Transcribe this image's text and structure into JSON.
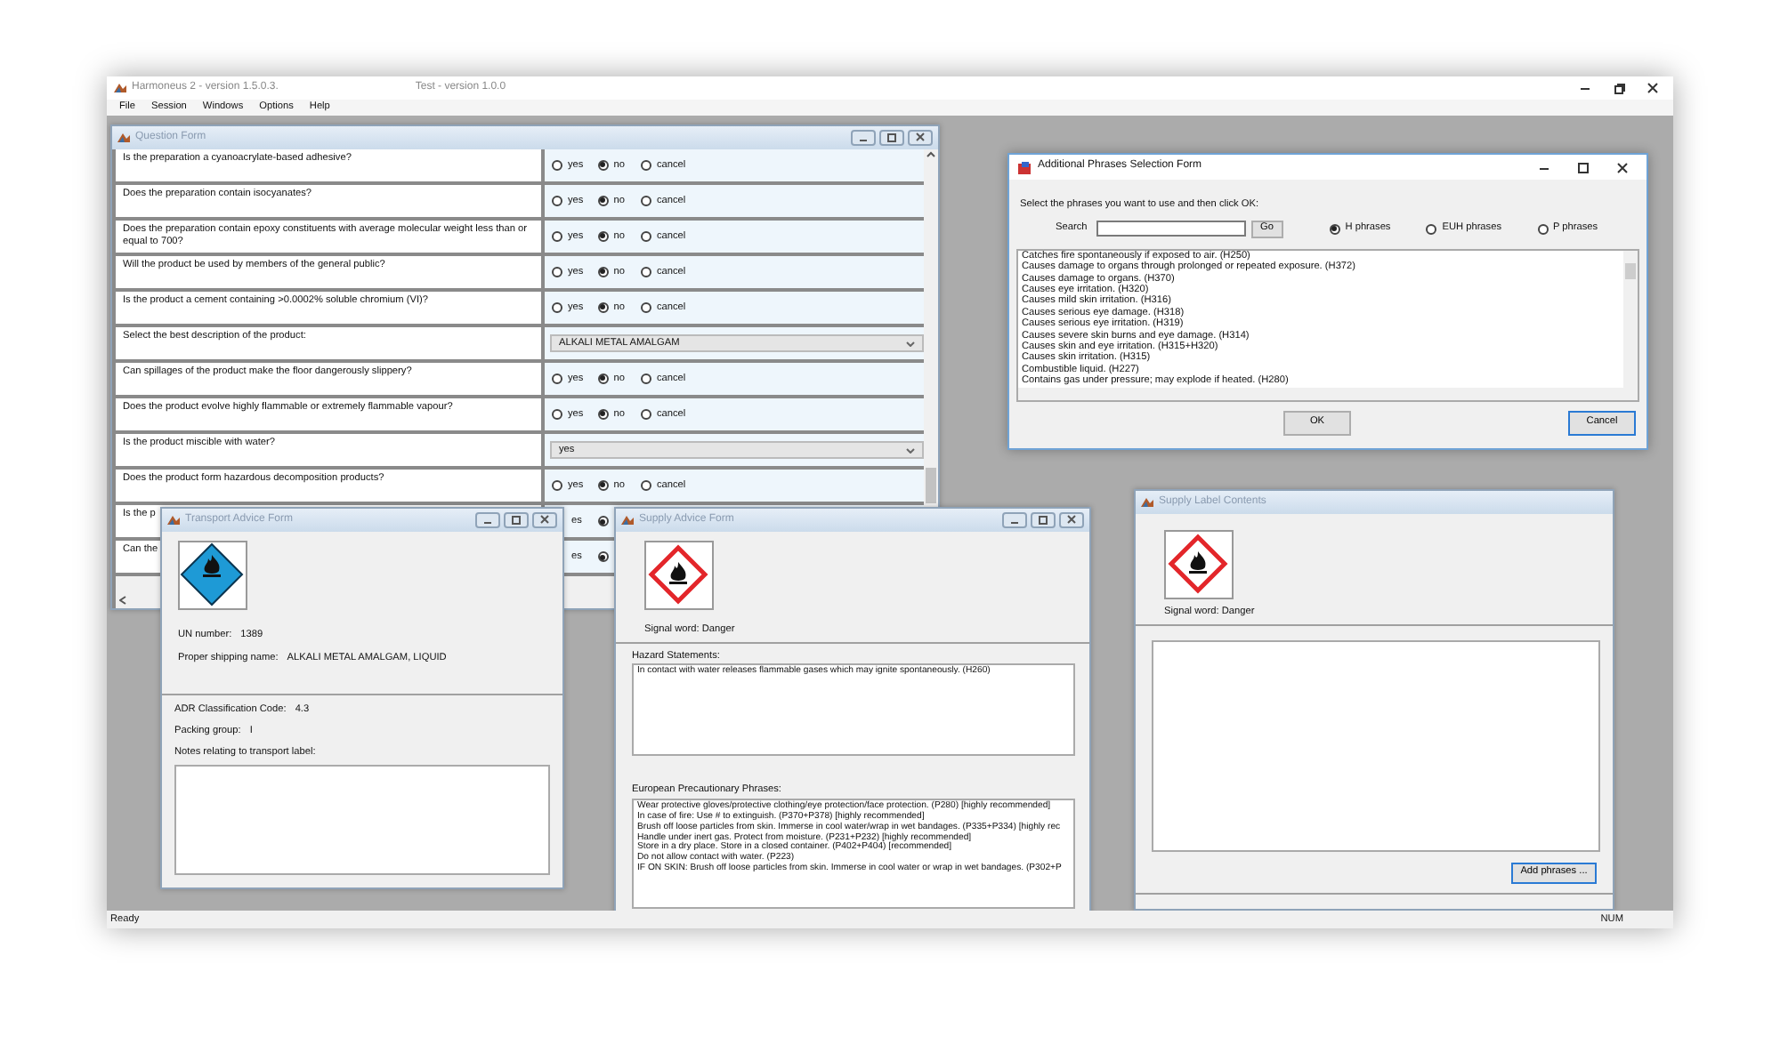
{
  "app": {
    "title": "Harmoneus 2 - version 1.5.0.3.",
    "subtitle": "Test - version 1.0.0"
  },
  "menu": [
    "File",
    "Session",
    "Windows",
    "Options",
    "Help"
  ],
  "question_form": {
    "title": "Question Form",
    "rows": [
      {
        "kind": "radio",
        "question": "Is the preparation a cyanoacrylate-based adhesive?",
        "options": [
          {
            "label": "yes",
            "selected": false
          },
          {
            "label": "no",
            "selected": true
          },
          {
            "label": "cancel",
            "selected": false
          }
        ]
      },
      {
        "kind": "radio",
        "question": "Does the preparation contain isocyanates?",
        "options": [
          {
            "label": "yes",
            "selected": false
          },
          {
            "label": "no",
            "selected": true
          },
          {
            "label": "cancel",
            "selected": false
          }
        ]
      },
      {
        "kind": "radio",
        "question": "Does the preparation contain epoxy constituents with average molecular weight less than or equal to 700?",
        "options": [
          {
            "label": "yes",
            "selected": false
          },
          {
            "label": "no",
            "selected": true
          },
          {
            "label": "cancel",
            "selected": false
          }
        ]
      },
      {
        "kind": "radio",
        "question": "Will the product be used by members of the general public?",
        "options": [
          {
            "label": "yes",
            "selected": false
          },
          {
            "label": "no",
            "selected": true
          },
          {
            "label": "cancel",
            "selected": false
          }
        ]
      },
      {
        "kind": "radio",
        "question": "Is the product a cement containing >0.0002% soluble chromium (VI)?",
        "options": [
          {
            "label": "yes",
            "selected": false
          },
          {
            "label": "no",
            "selected": true
          },
          {
            "label": "cancel",
            "selected": false
          }
        ]
      },
      {
        "kind": "select",
        "question": "Select the best description of the product:",
        "value": "ALKALI METAL AMALGAM"
      },
      {
        "kind": "radio",
        "question": "Can spillages of the product make the floor dangerously slippery?",
        "options": [
          {
            "label": "yes",
            "selected": false
          },
          {
            "label": "no",
            "selected": true
          },
          {
            "label": "cancel",
            "selected": false
          }
        ]
      },
      {
        "kind": "radio",
        "question": "Does the product evolve highly flammable or extremely flammable vapour?",
        "options": [
          {
            "label": "yes",
            "selected": false
          },
          {
            "label": "no",
            "selected": true
          },
          {
            "label": "cancel",
            "selected": false
          }
        ]
      },
      {
        "kind": "select",
        "question": "Is the product miscible with water?",
        "value": "yes"
      },
      {
        "kind": "radio",
        "question": "Does the product form hazardous decomposition products?",
        "options": [
          {
            "label": "yes",
            "selected": false
          },
          {
            "label": "no",
            "selected": true
          },
          {
            "label": "cancel",
            "selected": false
          }
        ]
      },
      {
        "kind": "covered",
        "question": "Is the p",
        "fragment": "es",
        "selected": true
      },
      {
        "kind": "covered",
        "question": "Can the",
        "fragment": "es",
        "selected": true
      }
    ]
  },
  "phrases_form": {
    "title": "Additional Phrases Selection Form",
    "instruction": "Select the phrases you want to use and then click OK:",
    "search_label": "Search",
    "search_button": "Go",
    "types": [
      {
        "label": "H phrases",
        "selected": true
      },
      {
        "label": "EUH phrases",
        "selected": false
      },
      {
        "label": "P phrases",
        "selected": false
      }
    ],
    "phrases": [
      "Catches fire spontaneously if exposed to air. (H250)",
      "Causes damage to organs through prolonged or repeated exposure. (H372)",
      "Causes damage to organs. (H370)",
      "Causes eye irritation. (H320)",
      "Causes mild skin irritation. (H316)",
      "Causes serious eye damage. (H318)",
      "Causes serious eye irritation. (H319)",
      "Causes severe skin burns and eye damage. (H314)",
      "Causes skin and eye irritation. (H315+H320)",
      "Causes skin irritation. (H315)",
      "Combustible liquid. (H227)",
      "Contains gas under pressure; may explode if heated. (H280)"
    ],
    "buttons": [
      {
        "label": "OK",
        "focused": false
      },
      {
        "label": "Cancel",
        "focused": true
      }
    ]
  },
  "transport_form": {
    "title": "Transport Advice Form",
    "fields": [
      {
        "label": "UN number:",
        "value": "1389"
      },
      {
        "label": "Proper shipping name:",
        "value": "ALKALI METAL AMALGAM, LIQUID"
      }
    ],
    "classification": [
      {
        "label": "ADR Classification Code:",
        "value": "4.3"
      },
      {
        "label": "Packing group:",
        "value": "I"
      }
    ],
    "notes_label": "Notes relating to transport label:"
  },
  "supply_form": {
    "title": "Supply Advice Form",
    "signal_word": "Signal word: Danger",
    "hazard_label": "Hazard Statements:",
    "hazard_lines": [
      "In contact with water releases flammable gases which may ignite spontaneously. (H260)"
    ],
    "precautionary_label": "European Precautionary Phrases:",
    "precautionary_lines": [
      "Wear protective gloves/protective clothing/eye protection/face protection. (P280) [highly recommended]",
      "In case of fire: Use # to extinguish. (P370+P378) [highly recommended]",
      "Brush off loose particles from skin. Immerse in cool water/wrap in wet bandages. (P335+P334) [highly rec",
      "Handle under inert gas. Protect from moisture. (P231+P232) [highly recommended]",
      "Store in a dry place. Store in a closed container. (P402+P404) [recommended]",
      "Do not allow contact with water. (P223)",
      "IF ON SKIN: Brush off loose particles from skin. Immerse in cool water or wrap in wet bandages. (P302+P"
    ]
  },
  "label_form": {
    "title": "Supply Label Contents",
    "signal_word": "Signal word: Danger",
    "add_button": {
      "label": "Add phrases ...",
      "focused": true
    }
  },
  "status_bar": {
    "left": "Ready",
    "right": "NUM"
  }
}
